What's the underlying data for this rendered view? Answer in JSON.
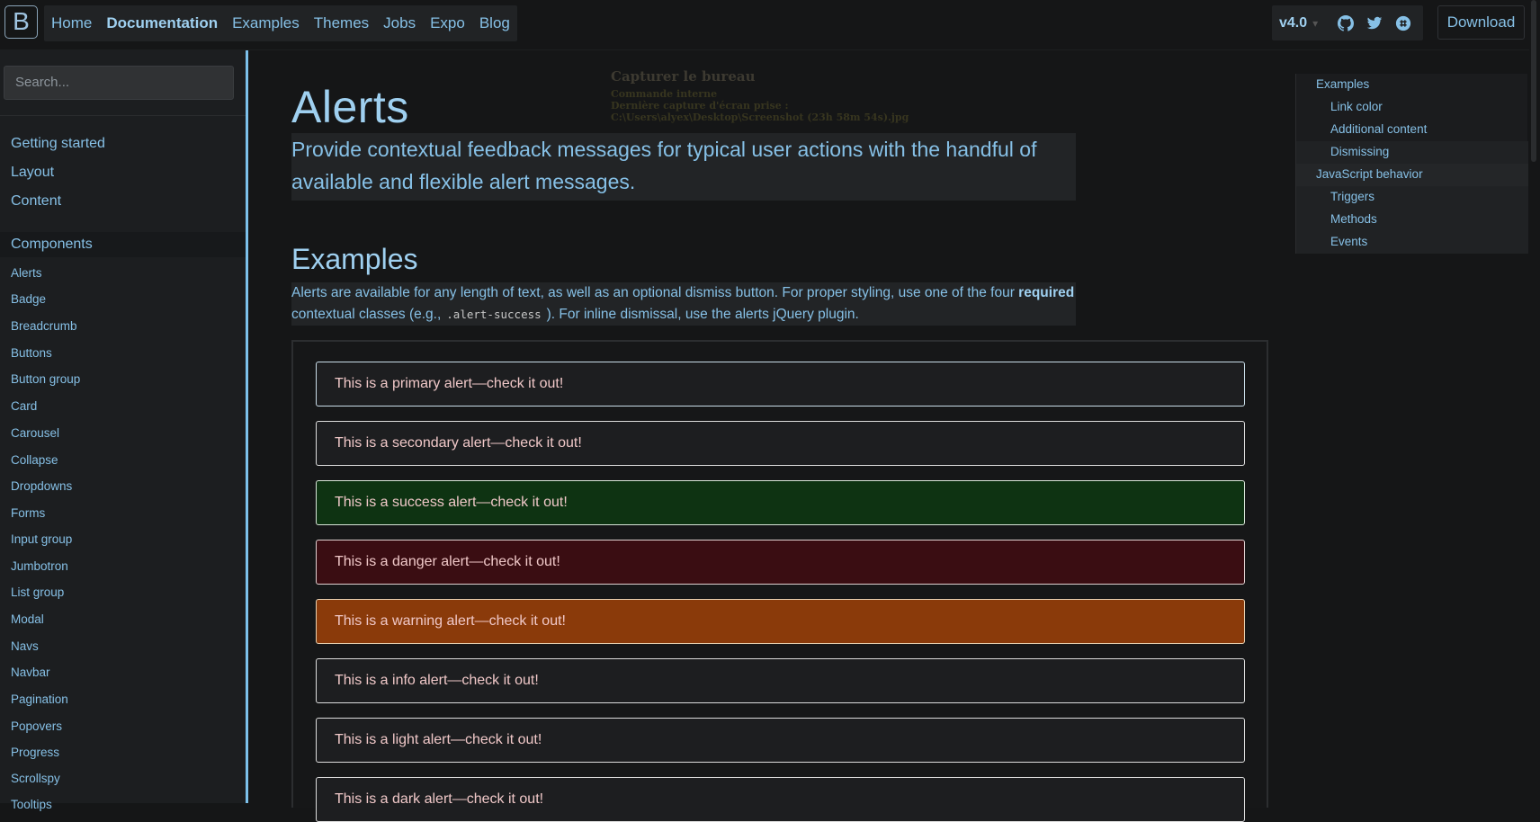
{
  "brand": {
    "letter": "B"
  },
  "nav": {
    "items": [
      "Home",
      "Documentation",
      "Examples",
      "Themes",
      "Jobs",
      "Expo",
      "Blog"
    ],
    "active": "Documentation"
  },
  "right_nav": {
    "version": "v4.0",
    "caret": "▾",
    "icons": [
      "github-icon",
      "twitter-icon",
      "slack-icon"
    ],
    "download": "Download"
  },
  "sidebar": {
    "search_placeholder": "Search...",
    "sections": [
      "Getting started",
      "Layout",
      "Content",
      "Components"
    ],
    "components": [
      "Alerts",
      "Badge",
      "Breadcrumb",
      "Buttons",
      "Button group",
      "Card",
      "Carousel",
      "Collapse",
      "Dropdowns",
      "Forms",
      "Input group",
      "Jumbotron",
      "List group",
      "Modal",
      "Navs",
      "Navbar",
      "Pagination",
      "Popovers",
      "Progress",
      "Scrollspy",
      "Tooltips"
    ]
  },
  "main": {
    "title": "Alerts",
    "lead": "Provide contextual feedback messages for typical user actions with the handful of available and flexible alert messages.",
    "examples_heading": "Examples",
    "para_part1": "Alerts are available for any length of text, as well as an optional dismiss button. For proper styling, use one of the four",
    "para_bold": "required",
    "para_part2": "contextual classes (e.g.,",
    "para_code": ".alert-success",
    "para_part3": "). For inline dismissal, use the alerts jQuery plugin.",
    "alerts": [
      {
        "text": "This is a primary alert—check it out!",
        "bg": "#1d1e20",
        "border": "#c9dde8"
      },
      {
        "text": "This is a secondary alert—check it out!",
        "bg": "#1d1e20",
        "border": "#dcdcdc"
      },
      {
        "text": "This is a success alert—check it out!",
        "bg": "#0e3312",
        "border": "#d8e4d8"
      },
      {
        "text": "This is a danger alert—check it out!",
        "bg": "#3a0d12",
        "border": "#e0d0d0"
      },
      {
        "text": "This is a warning alert—check it out!",
        "bg": "#8a3a0a",
        "border": "#e8d0b0"
      },
      {
        "text": "This is a info alert—check it out!",
        "bg": "#1d1e20",
        "border": "#dcdcdc"
      },
      {
        "text": "This is a light alert—check it out!",
        "bg": "#1d1e20",
        "border": "#dcdcdc"
      },
      {
        "text": "This is a dark alert—check it out!",
        "bg": "#1d1e20",
        "border": "#dcdcdc"
      }
    ]
  },
  "overlay": {
    "title": "Capturer le bureau",
    "line1": "Commande interne",
    "line2": "Dernière capture d'écran prise :",
    "line3": "C:\\Users\\alyex\\Desktop\\Screenshot (23h 58m 54s).jpg"
  },
  "toc": {
    "items": [
      {
        "label": "Examples",
        "level": 1
      },
      {
        "label": "Link color",
        "level": 2
      },
      {
        "label": "Additional content",
        "level": 2
      },
      {
        "label": "Dismissing",
        "level": 2
      },
      {
        "label": "JavaScript behavior",
        "level": 1
      },
      {
        "label": "Triggers",
        "level": 2
      },
      {
        "label": "Methods",
        "level": 2
      },
      {
        "label": "Events",
        "level": 2
      }
    ]
  },
  "colors": {
    "accent": "#86c0e6",
    "background": "#151617",
    "sidebar_border": "#7cc0ea"
  }
}
